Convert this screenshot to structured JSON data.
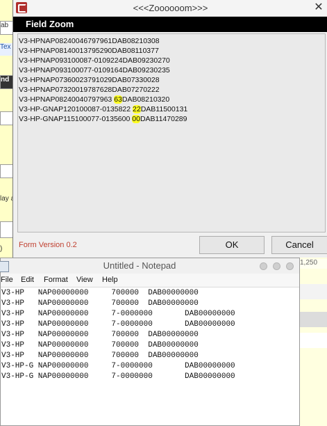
{
  "background": {
    "left_fragments": [
      "ab",
      "Tex",
      "nd",
      "lay a",
      ")"
    ],
    "right_fragment": "1,250"
  },
  "dialog": {
    "title": "<<<Zoooooom>>>",
    "header": "Field Zoom",
    "lines": [
      {
        "pre": "V3-HPNAP08240046797961DAB08210308",
        "hl": "",
        "post": ""
      },
      {
        "pre": "V3-HPNAP08140013795290DAB08110377",
        "hl": "",
        "post": ""
      },
      {
        "pre": "V3-HPNAP093100087-0109224DAB09230270",
        "hl": "",
        "post": ""
      },
      {
        "pre": "V3-HPNAP093100077-0109164DAB09230235",
        "hl": "",
        "post": ""
      },
      {
        "pre": "V3-HPNAP07360023791029DAB07330028",
        "hl": "",
        "post": ""
      },
      {
        "pre": "V3-HPNAP07320019787628DAB07270222",
        "hl": "",
        "post": ""
      },
      {
        "pre": "V3-HPNAP08240040797963 ",
        "hl": "63",
        "post": "DAB08210320"
      },
      {
        "pre": "V3-HP-GNAP120100087-0135822 ",
        "hl": "22",
        "post": "DAB11500131"
      },
      {
        "pre": "V3-HP-GNAP115100077-0135600 ",
        "hl": "00",
        "post": "DAB11470289"
      }
    ],
    "form_version": "Form Version 0.2",
    "ok_label": "OK",
    "cancel_label": "Cancel",
    "close_glyph": "✕"
  },
  "notepad": {
    "title": "Untitled - Notepad",
    "menu": [
      "File",
      "Edit",
      "Format",
      "View",
      "Help"
    ],
    "lines": [
      "V3-HP   NAP00000000     700000  DAB00000000",
      "V3-HP   NAP00000000     700000  DAB00000000",
      "V3-HP   NAP00000000     7-0000000       DAB00000000",
      "V3-HP   NAP00000000     7-0000000       DAB00000000",
      "V3-HP   NAP00000000     700000  DAB00000000",
      "V3-HP   NAP00000000     700000  DAB00000000",
      "V3-HP   NAP00000000     700000  DAB00000000",
      "V3-HP-G NAP00000000     7-0000000       DAB00000000",
      "V3-HP-G NAP00000000     7-0000000       DAB00000000"
    ]
  },
  "colors": {
    "highlight": "#ffff22",
    "form_version": "#c04030",
    "background_app": "#ffffc8"
  }
}
